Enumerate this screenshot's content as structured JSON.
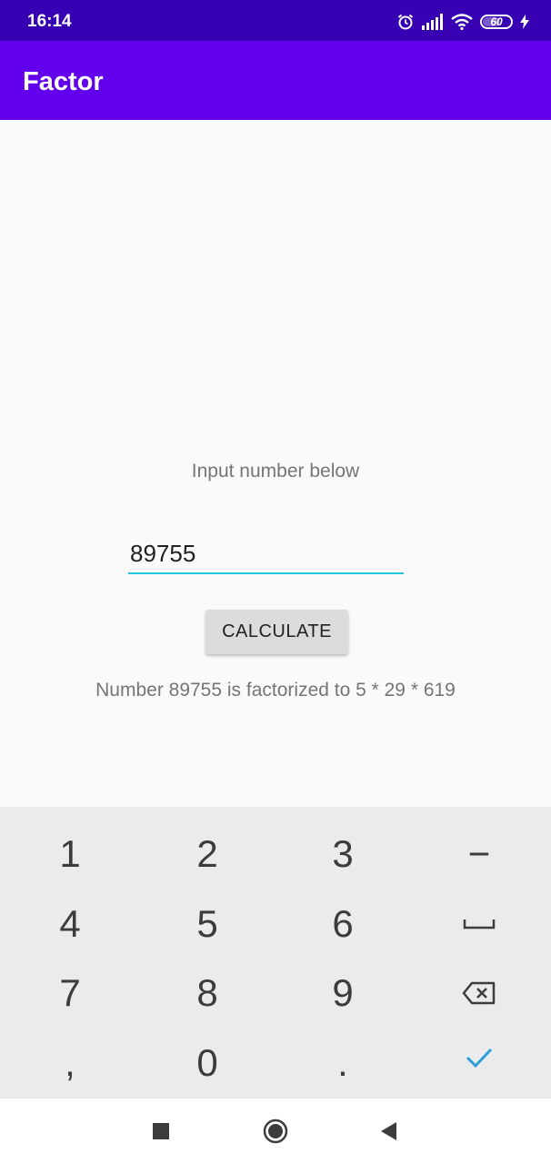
{
  "status_bar": {
    "time": "16:14",
    "battery_level": "60",
    "icons": [
      "alarm-icon",
      "signal-icon",
      "wifi-icon",
      "battery-icon",
      "charging-icon"
    ]
  },
  "app_bar": {
    "title": "Factor"
  },
  "main": {
    "prompt": "Input number below",
    "input_value": "89755",
    "button_label": "CALCULATE",
    "result": "Number 89755 is factorized to 5 * 29 * 619"
  },
  "keyboard": {
    "keys": [
      "1",
      "2",
      "3",
      "−",
      "4",
      "5",
      "6",
      "space",
      "7",
      "8",
      "9",
      "backspace",
      ",",
      "0",
      ".",
      "done"
    ],
    "accent_color": "#2a9fd6"
  },
  "nav_bar": {
    "buttons": [
      "recents-icon",
      "home-icon",
      "back-icon"
    ]
  },
  "colors": {
    "status_bar": "#3700b3",
    "app_bar": "#6200ee",
    "input_underline": "#26c6da"
  }
}
